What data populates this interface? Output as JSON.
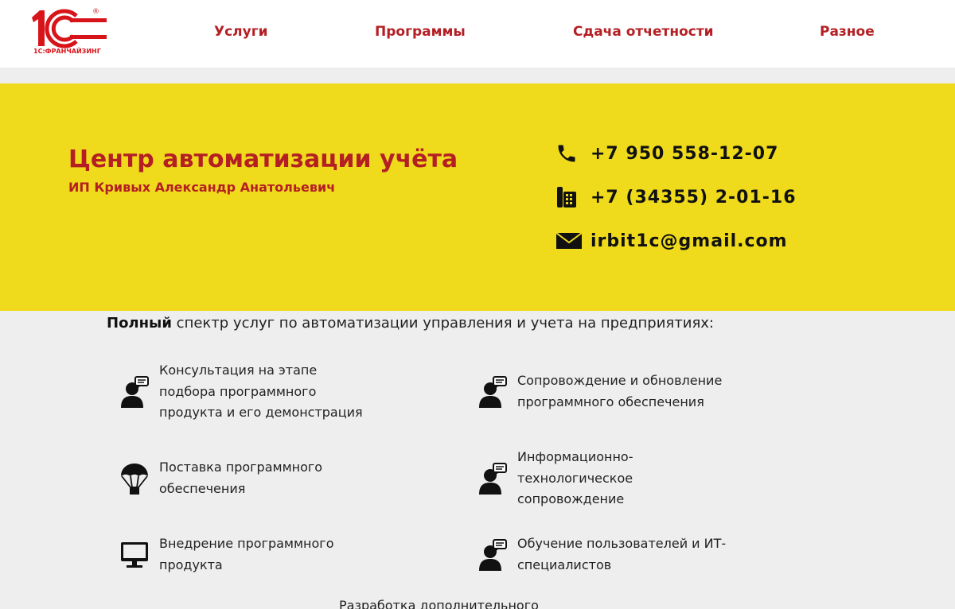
{
  "logo": {
    "main": "1С",
    "sub": "1С:ФРАНЧАЙЗИНГ",
    "mark": "®"
  },
  "nav": [
    {
      "label": "Услуги"
    },
    {
      "label": "Программы"
    },
    {
      "label": "Сдача отчетности"
    },
    {
      "label": "Разное"
    }
  ],
  "banner": {
    "title": "Центр автоматизации учёта",
    "subtitle": "ИП Кривых Александр Анатольевич",
    "contacts": [
      {
        "icon": "phone-icon",
        "text": "+7 950 558-12-07"
      },
      {
        "icon": "office-phone-icon",
        "text": "+7 (34355) 2-01-16"
      },
      {
        "icon": "envelope-icon",
        "text": "irbit1c@gmail.com"
      }
    ]
  },
  "intro": {
    "bold": "Полный",
    "rest": " спектр услуг по автоматизации управления и учета на предприятиях:"
  },
  "services": [
    {
      "icon": "consultant-icon",
      "lines": [
        "Консультация на этапе",
        "подбора программного",
        "продукта и его демонстрация"
      ]
    },
    {
      "icon": "consultant-icon",
      "lines": [
        "Сопровождение и обновление",
        "программного обеспечения"
      ]
    },
    {
      "icon": "parachute-icon",
      "lines": [
        "Поставка программного",
        "обеспечения"
      ]
    },
    {
      "icon": "consultant-icon",
      "lines": [
        "Информационно-",
        "технологическое",
        "сопровождение"
      ]
    },
    {
      "icon": "monitor-icon",
      "lines": [
        "Внедрение программного",
        "продукта"
      ]
    },
    {
      "icon": "consultant-icon",
      "lines": [
        "Обучение пользователей и ИТ-",
        "специалистов"
      ]
    }
  ],
  "cut_text": "Разработка дополнительного",
  "colors": {
    "brand_red": "#b41f24",
    "banner_yellow": "#efdb1b",
    "page_bg": "#eeeeee"
  }
}
